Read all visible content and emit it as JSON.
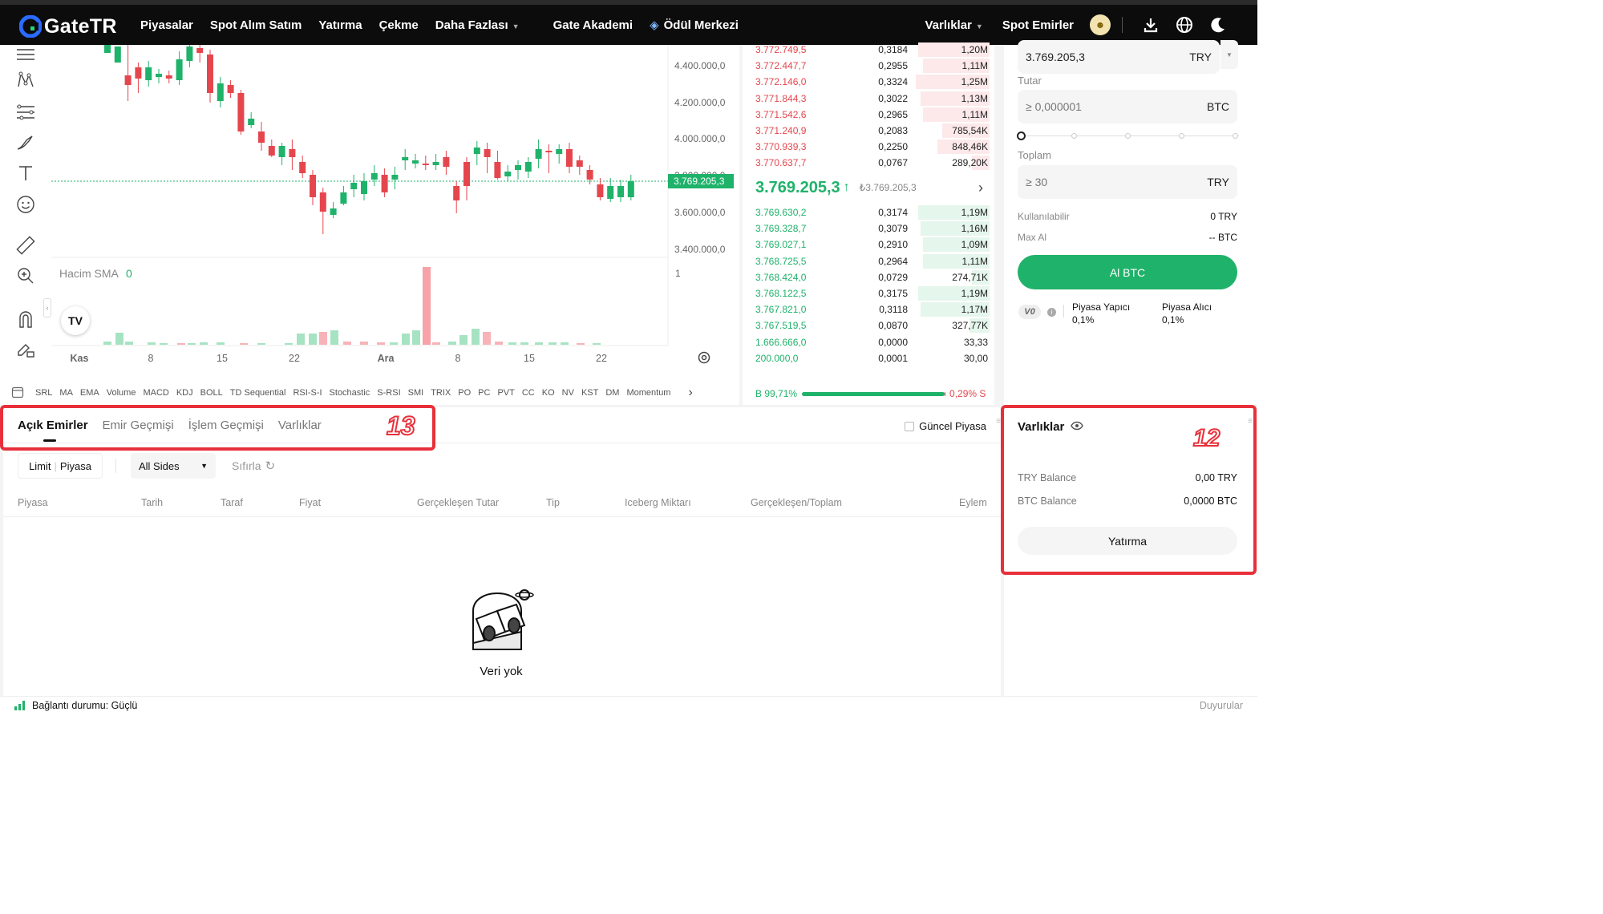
{
  "header": {
    "logo": "GateTR",
    "nav": [
      "Piyasalar",
      "Spot Alım Satım",
      "Yatırma",
      "Çekme",
      "Daha Fazlası",
      "Gate Akademi",
      "Ödül Merkezi"
    ],
    "right": {
      "assets": "Varlıklar",
      "spot_orders": "Spot Emirler"
    }
  },
  "chart": {
    "price_ticks": [
      "4.400.000,0",
      "4.200.000,0",
      "4.000.000,0",
      "3.800.000,0",
      "3.600.000,0",
      "3.400.000,0"
    ],
    "current_price_label": "3.769.205,3",
    "volume_label": "Hacim SMA",
    "volume_value": "0",
    "volume_axis": "1",
    "x_ticks": [
      "Kas",
      "8",
      "15",
      "22",
      "Ara",
      "8",
      "15",
      "22"
    ],
    "tv_badge": "TV",
    "indicators": [
      "SRL",
      "MA",
      "EMA",
      "Volume",
      "MACD",
      "KDJ",
      "BOLL",
      "TD Sequential",
      "RSI-S-I",
      "Stochastic",
      "S-RSI",
      "SMI",
      "TRIX",
      "PO",
      "PC",
      "PVT",
      "CC",
      "KO",
      "NV",
      "KST",
      "DM",
      "Momentum"
    ]
  },
  "orderbook": {
    "asks": [
      {
        "price": "3.772.749,5",
        "amount": "0,3184",
        "total": "1,20M",
        "depth": 0.29
      },
      {
        "price": "3.772.447,7",
        "amount": "0,2955",
        "total": "1,11M",
        "depth": 0.27
      },
      {
        "price": "3.772.146,0",
        "amount": "0,3324",
        "total": "1,25M",
        "depth": 0.3
      },
      {
        "price": "3.771.844,3",
        "amount": "0,3022",
        "total": "1,13M",
        "depth": 0.28
      },
      {
        "price": "3.771.542,6",
        "amount": "0,2965",
        "total": "1,11M",
        "depth": 0.27
      },
      {
        "price": "3.771.240,9",
        "amount": "0,2083",
        "total": "785,54K",
        "depth": 0.19
      },
      {
        "price": "3.770.939,3",
        "amount": "0,2250",
        "total": "848,46K",
        "depth": 0.21
      },
      {
        "price": "3.770.637,7",
        "amount": "0,0767",
        "total": "289,20K",
        "depth": 0.07
      }
    ],
    "last_price": "3.769.205,3",
    "last_price_arrow": "↑",
    "last_price_sub": "₺3.769.205,3",
    "bids": [
      {
        "price": "3.769.630,2",
        "amount": "0,3174",
        "total": "1,19M",
        "depth": 0.29
      },
      {
        "price": "3.769.328,7",
        "amount": "0,3079",
        "total": "1,16M",
        "depth": 0.28
      },
      {
        "price": "3.769.027,1",
        "amount": "0,2910",
        "total": "1,09M",
        "depth": 0.27
      },
      {
        "price": "3.768.725,5",
        "amount": "0,2964",
        "total": "1,11M",
        "depth": 0.27
      },
      {
        "price": "3.768.424,0",
        "amount": "0,0729",
        "total": "274,71K",
        "depth": 0.07
      },
      {
        "price": "3.768.122,5",
        "amount": "0,3175",
        "total": "1,19M",
        "depth": 0.29
      },
      {
        "price": "3.767.821,0",
        "amount": "0,3118",
        "total": "1,17M",
        "depth": 0.28
      },
      {
        "price": "3.767.519,5",
        "amount": "0,0870",
        "total": "327,77K",
        "depth": 0.08
      },
      {
        "price": "1.666.666,0",
        "amount": "0,0000",
        "total": "33,33",
        "depth": 0.0
      },
      {
        "price": "200.000,0",
        "amount": "0,0001",
        "total": "30,00",
        "depth": 0.0
      }
    ],
    "buy_ratio": "B 99,71%",
    "sell_ratio": "0,29% S",
    "buy_fraction": 0.9971
  },
  "form": {
    "price_value": "3.769.205,3",
    "price_unit": "TRY",
    "amount_label": "Tutar",
    "amount_placeholder": "≥ 0,000001",
    "amount_unit": "BTC",
    "slider_value": 0,
    "total_label": "Toplam",
    "total_placeholder": "≥ 30",
    "total_unit": "TRY",
    "available_label": "Kullanılabilir",
    "available_value": "0 TRY",
    "max_label": "Max Al",
    "max_value": "-- BTC",
    "buy_button": "Al BTC",
    "vip": "V0",
    "maker_label": "Piyasa Yapıcı",
    "maker_fee": "0,1%",
    "taker_label": "Piyasa Alıcı",
    "taker_fee": "0,1%"
  },
  "orders": {
    "tabs": [
      "Açık Emirler",
      "Emir Geçmişi",
      "İşlem Geçmişi",
      "Varlıklar"
    ],
    "current_market_label": "Güncel Piyasa",
    "filter_type_a": "Limit",
    "filter_type_b": "Piyasa",
    "sides": "All Sides",
    "reset": "Sıfırla",
    "columns": [
      "Piyasa",
      "Tarih",
      "Taraf",
      "Fiyat",
      "Gerçekleşen Tutar",
      "Tip",
      "Iceberg Miktarı",
      "Gerçekleşen/Toplam",
      "Eylem"
    ],
    "empty": "Veri yok",
    "annotation": "13"
  },
  "assets": {
    "title": "Varlıklar",
    "annotation": "12",
    "rows": [
      {
        "label": "TRY Balance",
        "value": "0,00 TRY"
      },
      {
        "label": "BTC Balance",
        "value": "0,0000 BTC"
      }
    ],
    "deposit_button": "Yatırma"
  },
  "footer": {
    "connection": "Bağlantı durumu: Güçlü",
    "news": "Duyurular"
  },
  "colors": {
    "up": "#1fb26a",
    "down": "#e5464d",
    "annotation": "#e8303a"
  }
}
